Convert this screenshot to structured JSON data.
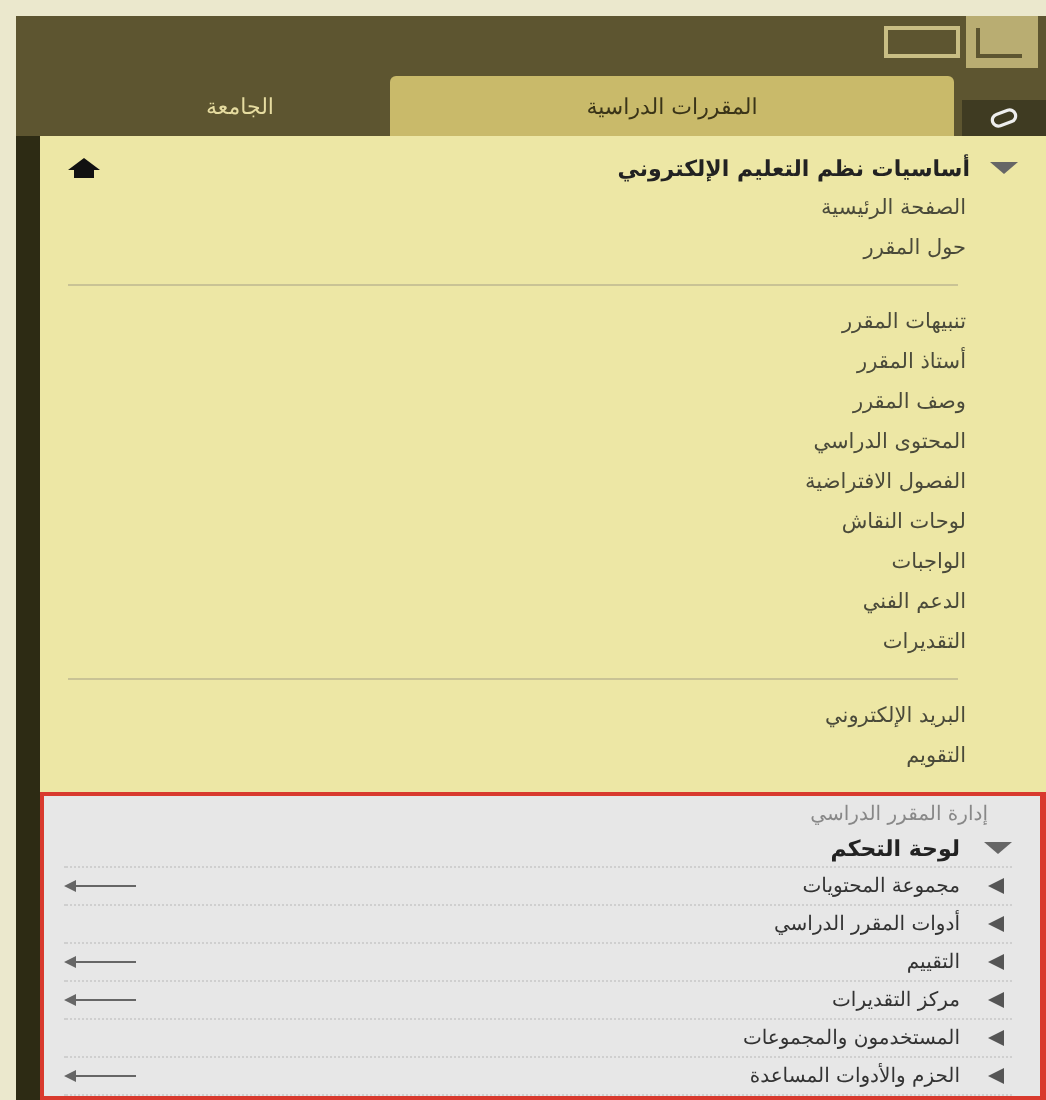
{
  "tabs": [
    {
      "label": "المقررات الدراسية",
      "selected": true
    },
    {
      "label": "الجامعة",
      "selected": false
    }
  ],
  "course": {
    "title": "أساسيات نظم التعليم الإلكتروني",
    "expanded": true
  },
  "menu_groups": [
    [
      "الصفحة الرئيسية",
      "حول المقرر"
    ],
    [
      "تنبيهات المقرر",
      "أستاذ المقرر",
      "وصف المقرر",
      "المحتوى الدراسي",
      "الفصول الافتراضية",
      "لوحات النقاش",
      "الواجبات",
      "الدعم الفني",
      "التقديرات"
    ],
    [
      "البريد الإلكتروني",
      "التقويم"
    ]
  ],
  "management": {
    "heading": "إدارة المقرر الدراسي",
    "panel": {
      "label": "لوحة التحكم",
      "expanded": true
    },
    "items": [
      {
        "label": "مجموعة المحتويات",
        "pointed": true
      },
      {
        "label": "أدوات المقرر الدراسي",
        "pointed": false
      },
      {
        "label": "التقييم",
        "pointed": true
      },
      {
        "label": "مركز التقديرات",
        "pointed": true
      },
      {
        "label": "المستخدمون والمجموعات",
        "pointed": false
      },
      {
        "label": "الحزم والأدوات المساعدة",
        "pointed": true
      }
    ]
  }
}
